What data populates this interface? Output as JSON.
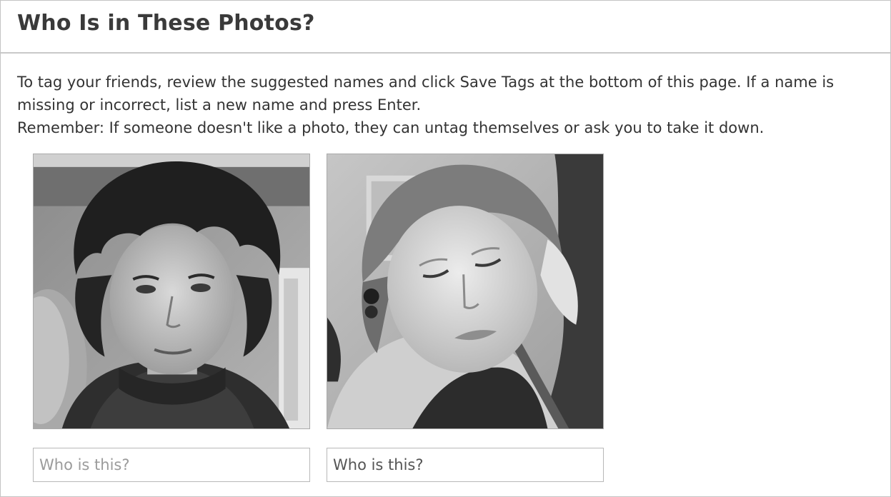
{
  "header": {
    "title": "Who Is in These Photos?"
  },
  "instructions": {
    "line1": "To tag your friends, review the suggested names and click Save Tags at the bottom of this page. If a name is missing or incorrect, list a new name and press Enter.",
    "line2": "Remember: If someone doesn't like a photo, they can untag themselves or ask you to take it down."
  },
  "photos": [
    {
      "tag_placeholder": "Who is this?",
      "tag_value": ""
    },
    {
      "tag_placeholder": "Who is this?",
      "tag_value": ""
    }
  ],
  "colors": {
    "divider": "#c9c9c9",
    "text": "#333333",
    "placeholder": "#9b9b9b"
  }
}
